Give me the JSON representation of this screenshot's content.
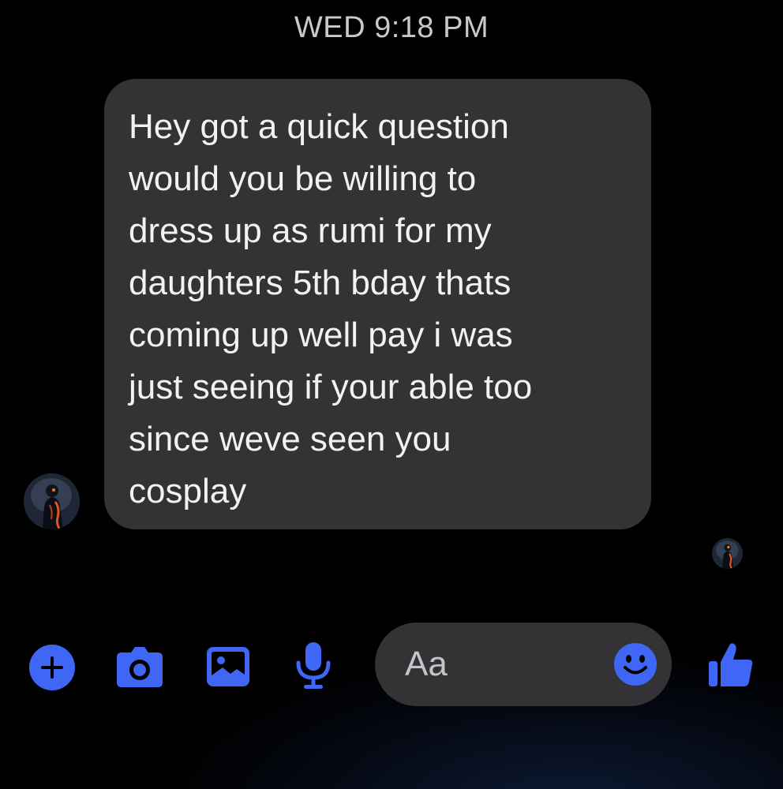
{
  "header": {
    "timestamp": "WED 9:18 PM"
  },
  "conversation": {
    "message": {
      "lines": [
        "Hey got a quick question",
        "would you be willing to",
        "dress up as rumi for my",
        "daughters 5th bday thats",
        "coming up well pay i was",
        "just seeing if your able too",
        "since weve seen you",
        "cosplay"
      ]
    }
  },
  "composer": {
    "placeholder": "Aa",
    "icons": {
      "add": "plus-icon",
      "camera": "camera-icon",
      "gallery": "image-icon",
      "voice": "microphone-icon",
      "emoji": "smiley-icon",
      "like": "thumbs-up-icon"
    }
  },
  "colors": {
    "accent": "#3f66f5",
    "bubble": "#333335",
    "background": "#000000",
    "timestamp_text": "#c9c9cc"
  }
}
